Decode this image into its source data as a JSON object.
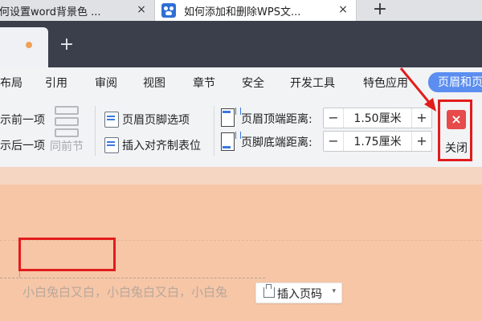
{
  "browser": {
    "tabs": [
      {
        "title": "如何设置word背景色 ...",
        "close": "×"
      },
      {
        "title": "如何添加和删除WPS文...",
        "close": "×"
      }
    ],
    "new_tab": "+"
  },
  "wps": {
    "new_tab": "+",
    "menu": [
      "布局",
      "引用",
      "审阅",
      "视图",
      "章节",
      "安全",
      "开发工具",
      "特色应用",
      "页眉和页脚"
    ],
    "active_menu": "页眉和页脚"
  },
  "toolbar": {
    "prev_item": "显示前一项",
    "next_item": "显示后一项",
    "same_as_prev": "同前节",
    "header_footer_options": "页眉页脚选项",
    "insert_aligned_tab": "插入对齐制表位",
    "header_top_label": "页眉顶端距离:",
    "header_top_value": "1.50厘米",
    "footer_bottom_label": "页脚底端距离:",
    "footer_bottom_value": "1.75厘米",
    "minus": "−",
    "plus": "+",
    "close_label": "关闭",
    "close_icon": "×"
  },
  "document": {
    "body_text": "小白兔白又白，小白兔白又白，小白兔",
    "insert_page_number": "插入页码",
    "caret": "▾"
  },
  "colors": {
    "annotation_red": "#e21c1c",
    "page_background": "#f6c6a7",
    "active_tab": "#5b8ef0"
  }
}
